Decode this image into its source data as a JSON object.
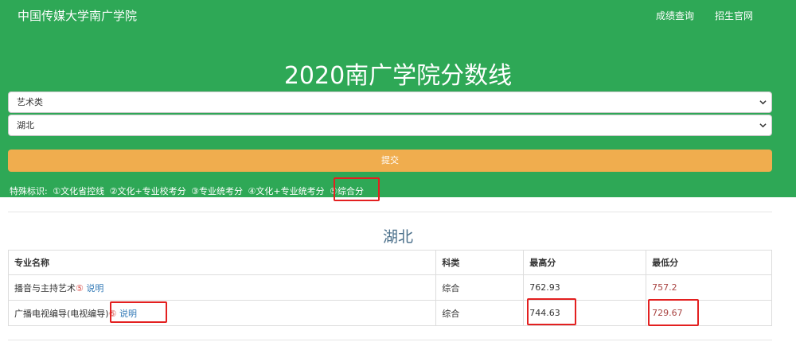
{
  "header": {
    "brand": "中国传媒大学南广学院",
    "nav": [
      "成绩查询",
      "招生官网"
    ]
  },
  "hero": {
    "title": "2020南广学院分数线"
  },
  "form": {
    "category_value": "艺术类",
    "province_value": "湖北",
    "submit_label": "提交"
  },
  "legend": {
    "label": "特殊标识:",
    "items": [
      "①文化省控线",
      "②文化+专业校考分",
      "③专业统考分",
      "④文化+专业统考分",
      "⑤综合分"
    ]
  },
  "results": {
    "region": "湖北",
    "columns": [
      "专业名称",
      "科类",
      "最高分",
      "最低分"
    ],
    "rows": [
      {
        "name": "播音与主持艺术",
        "badge": "⑤",
        "note": "说明",
        "type": "综合",
        "max": "762.93",
        "min": "757.2"
      },
      {
        "name": "广播电视编导(电视编导)",
        "badge": "⑤",
        "note": "说明",
        "type": "综合",
        "max": "744.63",
        "min": "729.67"
      }
    ]
  },
  "colors": {
    "hero_bg": "#2ea856",
    "submit_bg": "#f0ad4e",
    "highlight_box": "#e32020",
    "link": "#337ab7",
    "low_score": "#a94442"
  }
}
